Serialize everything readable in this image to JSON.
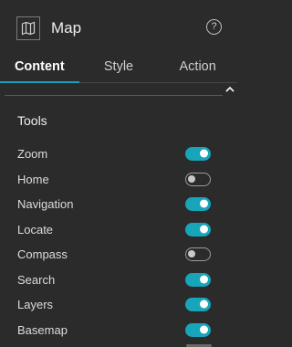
{
  "header": {
    "title": "Map",
    "icon": "map-icon",
    "help_icon": "help-icon",
    "help_glyph": "?"
  },
  "tabs": [
    {
      "label": "Content",
      "active": true
    },
    {
      "label": "Style",
      "active": false
    },
    {
      "label": "Action",
      "active": false
    }
  ],
  "tools": {
    "title": "Tools",
    "items": [
      {
        "label": "Zoom",
        "enabled": true
      },
      {
        "label": "Home",
        "enabled": false
      },
      {
        "label": "Navigation",
        "enabled": true
      },
      {
        "label": "Locate",
        "enabled": true
      },
      {
        "label": "Compass",
        "enabled": false
      },
      {
        "label": "Search",
        "enabled": true
      },
      {
        "label": "Layers",
        "enabled": true
      },
      {
        "label": "Basemap",
        "enabled": true
      }
    ]
  },
  "colors": {
    "accent": "#18a4b9",
    "background": "#2b2b2b"
  }
}
